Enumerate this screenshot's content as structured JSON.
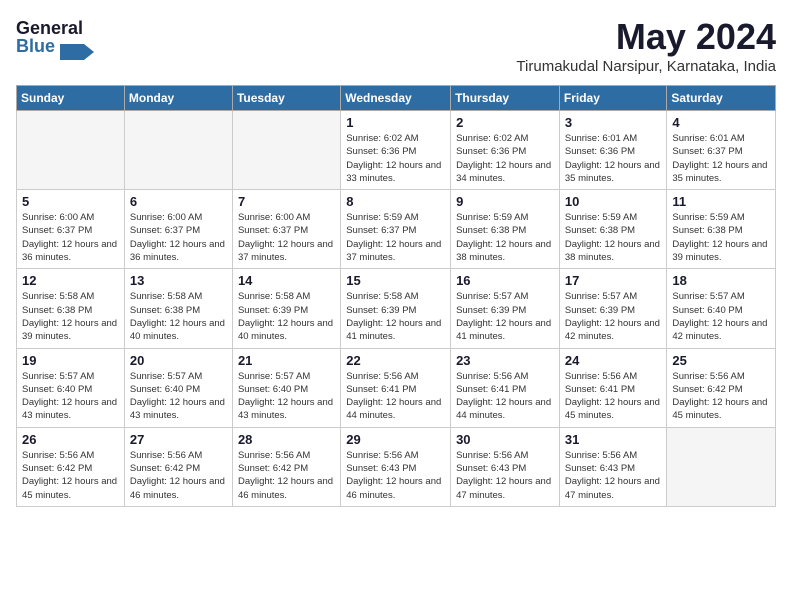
{
  "header": {
    "logo_general": "General",
    "logo_blue": "Blue",
    "month_year": "May 2024",
    "location": "Tirumakudal Narsipur, Karnataka, India"
  },
  "days_of_week": [
    "Sunday",
    "Monday",
    "Tuesday",
    "Wednesday",
    "Thursday",
    "Friday",
    "Saturday"
  ],
  "weeks": [
    [
      {
        "day": "",
        "info": ""
      },
      {
        "day": "",
        "info": ""
      },
      {
        "day": "",
        "info": ""
      },
      {
        "day": "1",
        "info": "Sunrise: 6:02 AM\nSunset: 6:36 PM\nDaylight: 12 hours and 33 minutes."
      },
      {
        "day": "2",
        "info": "Sunrise: 6:02 AM\nSunset: 6:36 PM\nDaylight: 12 hours and 34 minutes."
      },
      {
        "day": "3",
        "info": "Sunrise: 6:01 AM\nSunset: 6:36 PM\nDaylight: 12 hours and 35 minutes."
      },
      {
        "day": "4",
        "info": "Sunrise: 6:01 AM\nSunset: 6:37 PM\nDaylight: 12 hours and 35 minutes."
      }
    ],
    [
      {
        "day": "5",
        "info": "Sunrise: 6:00 AM\nSunset: 6:37 PM\nDaylight: 12 hours and 36 minutes."
      },
      {
        "day": "6",
        "info": "Sunrise: 6:00 AM\nSunset: 6:37 PM\nDaylight: 12 hours and 36 minutes."
      },
      {
        "day": "7",
        "info": "Sunrise: 6:00 AM\nSunset: 6:37 PM\nDaylight: 12 hours and 37 minutes."
      },
      {
        "day": "8",
        "info": "Sunrise: 5:59 AM\nSunset: 6:37 PM\nDaylight: 12 hours and 37 minutes."
      },
      {
        "day": "9",
        "info": "Sunrise: 5:59 AM\nSunset: 6:38 PM\nDaylight: 12 hours and 38 minutes."
      },
      {
        "day": "10",
        "info": "Sunrise: 5:59 AM\nSunset: 6:38 PM\nDaylight: 12 hours and 38 minutes."
      },
      {
        "day": "11",
        "info": "Sunrise: 5:59 AM\nSunset: 6:38 PM\nDaylight: 12 hours and 39 minutes."
      }
    ],
    [
      {
        "day": "12",
        "info": "Sunrise: 5:58 AM\nSunset: 6:38 PM\nDaylight: 12 hours and 39 minutes."
      },
      {
        "day": "13",
        "info": "Sunrise: 5:58 AM\nSunset: 6:38 PM\nDaylight: 12 hours and 40 minutes."
      },
      {
        "day": "14",
        "info": "Sunrise: 5:58 AM\nSunset: 6:39 PM\nDaylight: 12 hours and 40 minutes."
      },
      {
        "day": "15",
        "info": "Sunrise: 5:58 AM\nSunset: 6:39 PM\nDaylight: 12 hours and 41 minutes."
      },
      {
        "day": "16",
        "info": "Sunrise: 5:57 AM\nSunset: 6:39 PM\nDaylight: 12 hours and 41 minutes."
      },
      {
        "day": "17",
        "info": "Sunrise: 5:57 AM\nSunset: 6:39 PM\nDaylight: 12 hours and 42 minutes."
      },
      {
        "day": "18",
        "info": "Sunrise: 5:57 AM\nSunset: 6:40 PM\nDaylight: 12 hours and 42 minutes."
      }
    ],
    [
      {
        "day": "19",
        "info": "Sunrise: 5:57 AM\nSunset: 6:40 PM\nDaylight: 12 hours and 43 minutes."
      },
      {
        "day": "20",
        "info": "Sunrise: 5:57 AM\nSunset: 6:40 PM\nDaylight: 12 hours and 43 minutes."
      },
      {
        "day": "21",
        "info": "Sunrise: 5:57 AM\nSunset: 6:40 PM\nDaylight: 12 hours and 43 minutes."
      },
      {
        "day": "22",
        "info": "Sunrise: 5:56 AM\nSunset: 6:41 PM\nDaylight: 12 hours and 44 minutes."
      },
      {
        "day": "23",
        "info": "Sunrise: 5:56 AM\nSunset: 6:41 PM\nDaylight: 12 hours and 44 minutes."
      },
      {
        "day": "24",
        "info": "Sunrise: 5:56 AM\nSunset: 6:41 PM\nDaylight: 12 hours and 45 minutes."
      },
      {
        "day": "25",
        "info": "Sunrise: 5:56 AM\nSunset: 6:42 PM\nDaylight: 12 hours and 45 minutes."
      }
    ],
    [
      {
        "day": "26",
        "info": "Sunrise: 5:56 AM\nSunset: 6:42 PM\nDaylight: 12 hours and 45 minutes."
      },
      {
        "day": "27",
        "info": "Sunrise: 5:56 AM\nSunset: 6:42 PM\nDaylight: 12 hours and 46 minutes."
      },
      {
        "day": "28",
        "info": "Sunrise: 5:56 AM\nSunset: 6:42 PM\nDaylight: 12 hours and 46 minutes."
      },
      {
        "day": "29",
        "info": "Sunrise: 5:56 AM\nSunset: 6:43 PM\nDaylight: 12 hours and 46 minutes."
      },
      {
        "day": "30",
        "info": "Sunrise: 5:56 AM\nSunset: 6:43 PM\nDaylight: 12 hours and 47 minutes."
      },
      {
        "day": "31",
        "info": "Sunrise: 5:56 AM\nSunset: 6:43 PM\nDaylight: 12 hours and 47 minutes."
      },
      {
        "day": "",
        "info": ""
      }
    ]
  ]
}
